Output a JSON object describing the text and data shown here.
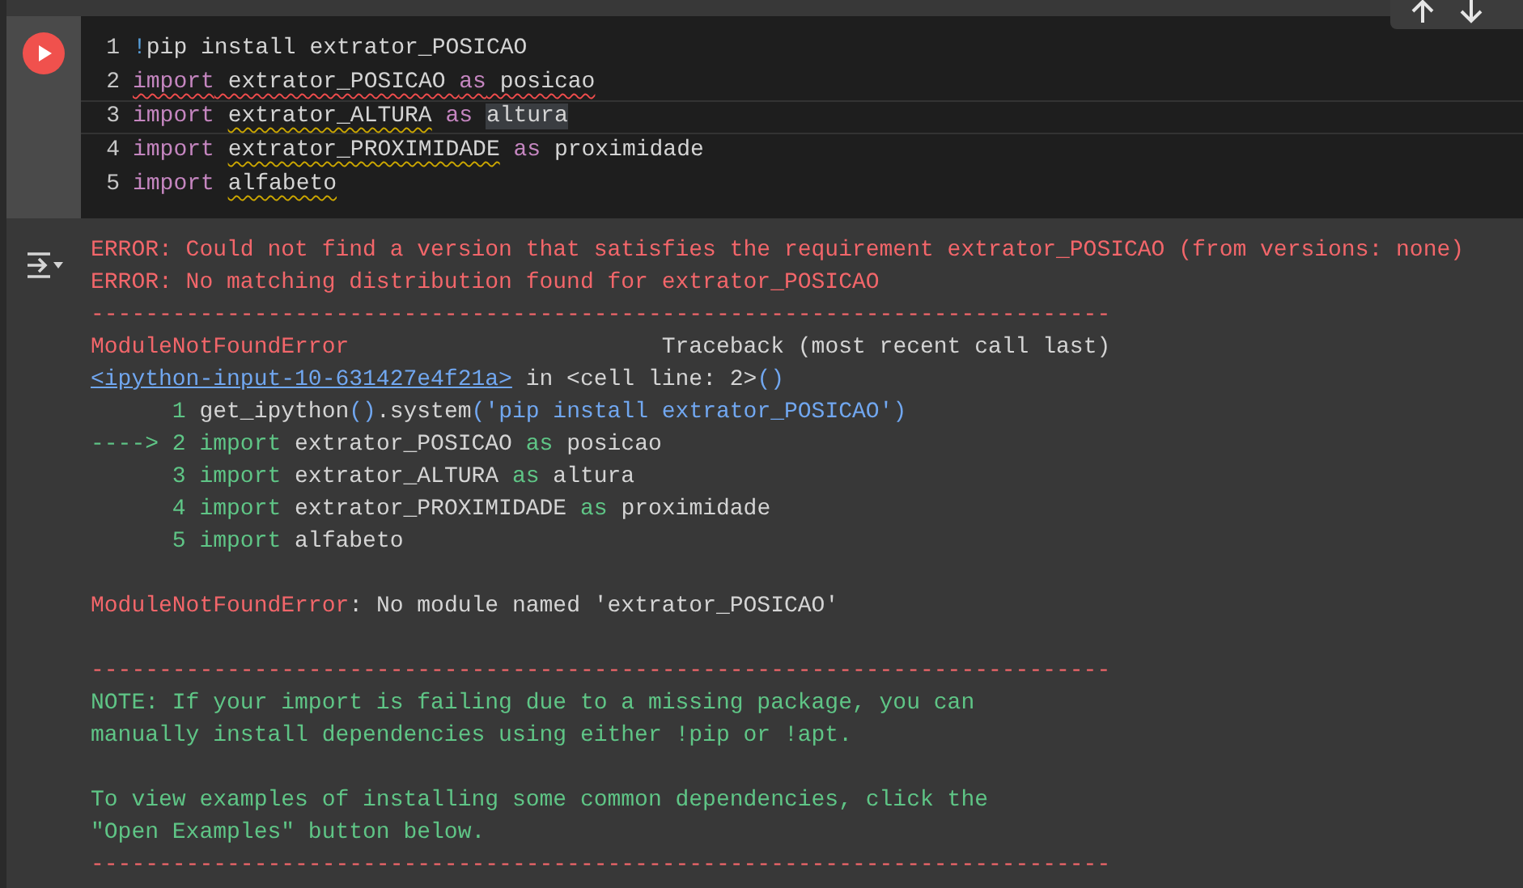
{
  "code_cell": {
    "lines": [
      {
        "number": "1",
        "active": false,
        "tokens": [
          {
            "kind": "bang",
            "text": "!"
          },
          {
            "kind": "plain",
            "text": "pip install extrator_POSICAO"
          }
        ]
      },
      {
        "number": "2",
        "active": false,
        "tokens": [
          {
            "kind": "keyword",
            "text": "import",
            "error": true
          },
          {
            "kind": "plain",
            "text": " extrator_POSICAO ",
            "error": true
          },
          {
            "kind": "keyword",
            "text": "as",
            "error": true
          },
          {
            "kind": "plain",
            "text": " posicao",
            "error": true
          }
        ]
      },
      {
        "number": "3",
        "active": true,
        "tokens": [
          {
            "kind": "keyword",
            "text": "import "
          },
          {
            "kind": "plain",
            "text": "extrator_ALTURA",
            "warning": true
          },
          {
            "kind": "keyword",
            "text": " as "
          },
          {
            "kind": "plain",
            "text": "altura",
            "highlighted": true
          }
        ]
      },
      {
        "number": "4",
        "active": false,
        "tokens": [
          {
            "kind": "keyword",
            "text": "import "
          },
          {
            "kind": "plain",
            "text": "extrator_PROXIMIDADE",
            "warning": true
          },
          {
            "kind": "keyword",
            "text": " as "
          },
          {
            "kind": "plain",
            "text": "proximidade"
          }
        ]
      },
      {
        "number": "5",
        "active": false,
        "tokens": [
          {
            "kind": "keyword",
            "text": "import "
          },
          {
            "kind": "plain",
            "text": "alfabeto",
            "warning": true
          }
        ]
      }
    ]
  },
  "output": {
    "blocks": [
      {
        "lines": [
          {
            "segments": [
              {
                "kind": "error",
                "text": "ERROR: Could not find a version that satisfies the requirement extrator_POSICAO (from versions: none)"
              }
            ]
          },
          {
            "segments": [
              {
                "kind": "error",
                "text": "ERROR: No matching distribution found for extrator_POSICAO"
              }
            ]
          },
          {
            "segments": [
              {
                "kind": "error",
                "text": "---------------------------------------------------------------------------"
              }
            ]
          },
          {
            "segments": [
              {
                "kind": "error",
                "text": "ModuleNotFoundError"
              },
              {
                "kind": "plain",
                "text": "                       Traceback (most recent call last)"
              }
            ]
          },
          {
            "segments": [
              {
                "kind": "link",
                "text": "<ipython-input-10-631427e4f21a>"
              },
              {
                "kind": "plain",
                "text": " in <cell line: 2>"
              },
              {
                "kind": "blue",
                "text": "()"
              }
            ]
          },
          {
            "segments": [
              {
                "kind": "green",
                "text": "      1 "
              },
              {
                "kind": "plain",
                "text": "get_ipython"
              },
              {
                "kind": "blue",
                "text": "()"
              },
              {
                "kind": "plain",
                "text": ".system"
              },
              {
                "kind": "blue",
                "text": "('pip install extrator_POSICAO')"
              }
            ]
          },
          {
            "segments": [
              {
                "kind": "green",
                "text": "----> 2 import "
              },
              {
                "kind": "plain",
                "text": "extrator_POSICAO "
              },
              {
                "kind": "green",
                "text": "as "
              },
              {
                "kind": "plain",
                "text": "posicao"
              }
            ]
          },
          {
            "segments": [
              {
                "kind": "green",
                "text": "      3 import "
              },
              {
                "kind": "plain",
                "text": "extrator_ALTURA "
              },
              {
                "kind": "green",
                "text": "as "
              },
              {
                "kind": "plain",
                "text": "altura"
              }
            ]
          },
          {
            "segments": [
              {
                "kind": "green",
                "text": "      4 import "
              },
              {
                "kind": "plain",
                "text": "extrator_PROXIMIDADE "
              },
              {
                "kind": "green",
                "text": "as "
              },
              {
                "kind": "plain",
                "text": "proximidade"
              }
            ]
          },
          {
            "segments": [
              {
                "kind": "green",
                "text": "      5 import "
              },
              {
                "kind": "plain",
                "text": "alfabeto"
              }
            ]
          }
        ]
      },
      {
        "lines": [
          {
            "segments": [
              {
                "kind": "error",
                "text": "ModuleNotFoundError"
              },
              {
                "kind": "plain",
                "text": ": No module named 'extrator_POSICAO'"
              }
            ]
          }
        ]
      },
      {
        "lines": [
          {
            "segments": [
              {
                "kind": "error",
                "text": "---------------------------------------------------------------------------"
              }
            ]
          },
          {
            "segments": [
              {
                "kind": "green",
                "text": "NOTE: If your import is failing due to a missing package, you can"
              }
            ]
          },
          {
            "segments": [
              {
                "kind": "green",
                "text": "manually install dependencies using either !pip or !apt."
              }
            ]
          }
        ]
      },
      {
        "lines": [
          {
            "segments": [
              {
                "kind": "green",
                "text": "To view examples of installing some common dependencies, click the"
              }
            ]
          },
          {
            "segments": [
              {
                "kind": "green",
                "text": "\"Open Examples\" button below."
              }
            ]
          },
          {
            "segments": [
              {
                "kind": "error",
                "text": "---------------------------------------------------------------------------"
              }
            ]
          }
        ]
      }
    ]
  }
}
